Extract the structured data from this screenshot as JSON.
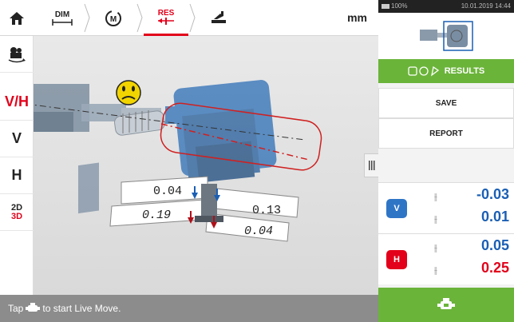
{
  "toolbar": {
    "dim_label": "DIM",
    "res_label": "RES",
    "units": "mm"
  },
  "left_tools": {
    "vh": "V/H",
    "v": "V",
    "h": "H",
    "two_d": "2D",
    "three_d": "3D"
  },
  "status_bar": {
    "prefix": "Tap",
    "suffix": "to start Live Move."
  },
  "android_status": {
    "battery": "100%",
    "datetime": "10.01.2019 14:44"
  },
  "right_panel": {
    "results_tab": "RESULTS",
    "save": "SAVE",
    "report": "REPORT",
    "vertical": {
      "tag": "V",
      "offset": "-0.03",
      "angularity": "0.01"
    },
    "horizontal": {
      "tag": "H",
      "offset": "0.05",
      "angularity": "0.25"
    }
  },
  "view": {
    "coupling_values": {
      "top_left": "0.04",
      "top_right": "0.13",
      "bottom_left": "0.19",
      "bottom_right": "0.04"
    }
  },
  "colors": {
    "accent_green": "#6bb43a",
    "red": "#e2001a",
    "blue": "#1a5fb4",
    "dark_red_value": "#e2001a",
    "blue_value": "#1a5fb4"
  },
  "icons": {
    "home": "home-icon",
    "dimensions": "dimensions-icon",
    "measure": "measure-icon",
    "results": "results-icon",
    "move": "machine-move-icon",
    "camera": "camera-rotate-icon",
    "smiley": "sad-face-icon",
    "live_move": "live-move-icon"
  }
}
